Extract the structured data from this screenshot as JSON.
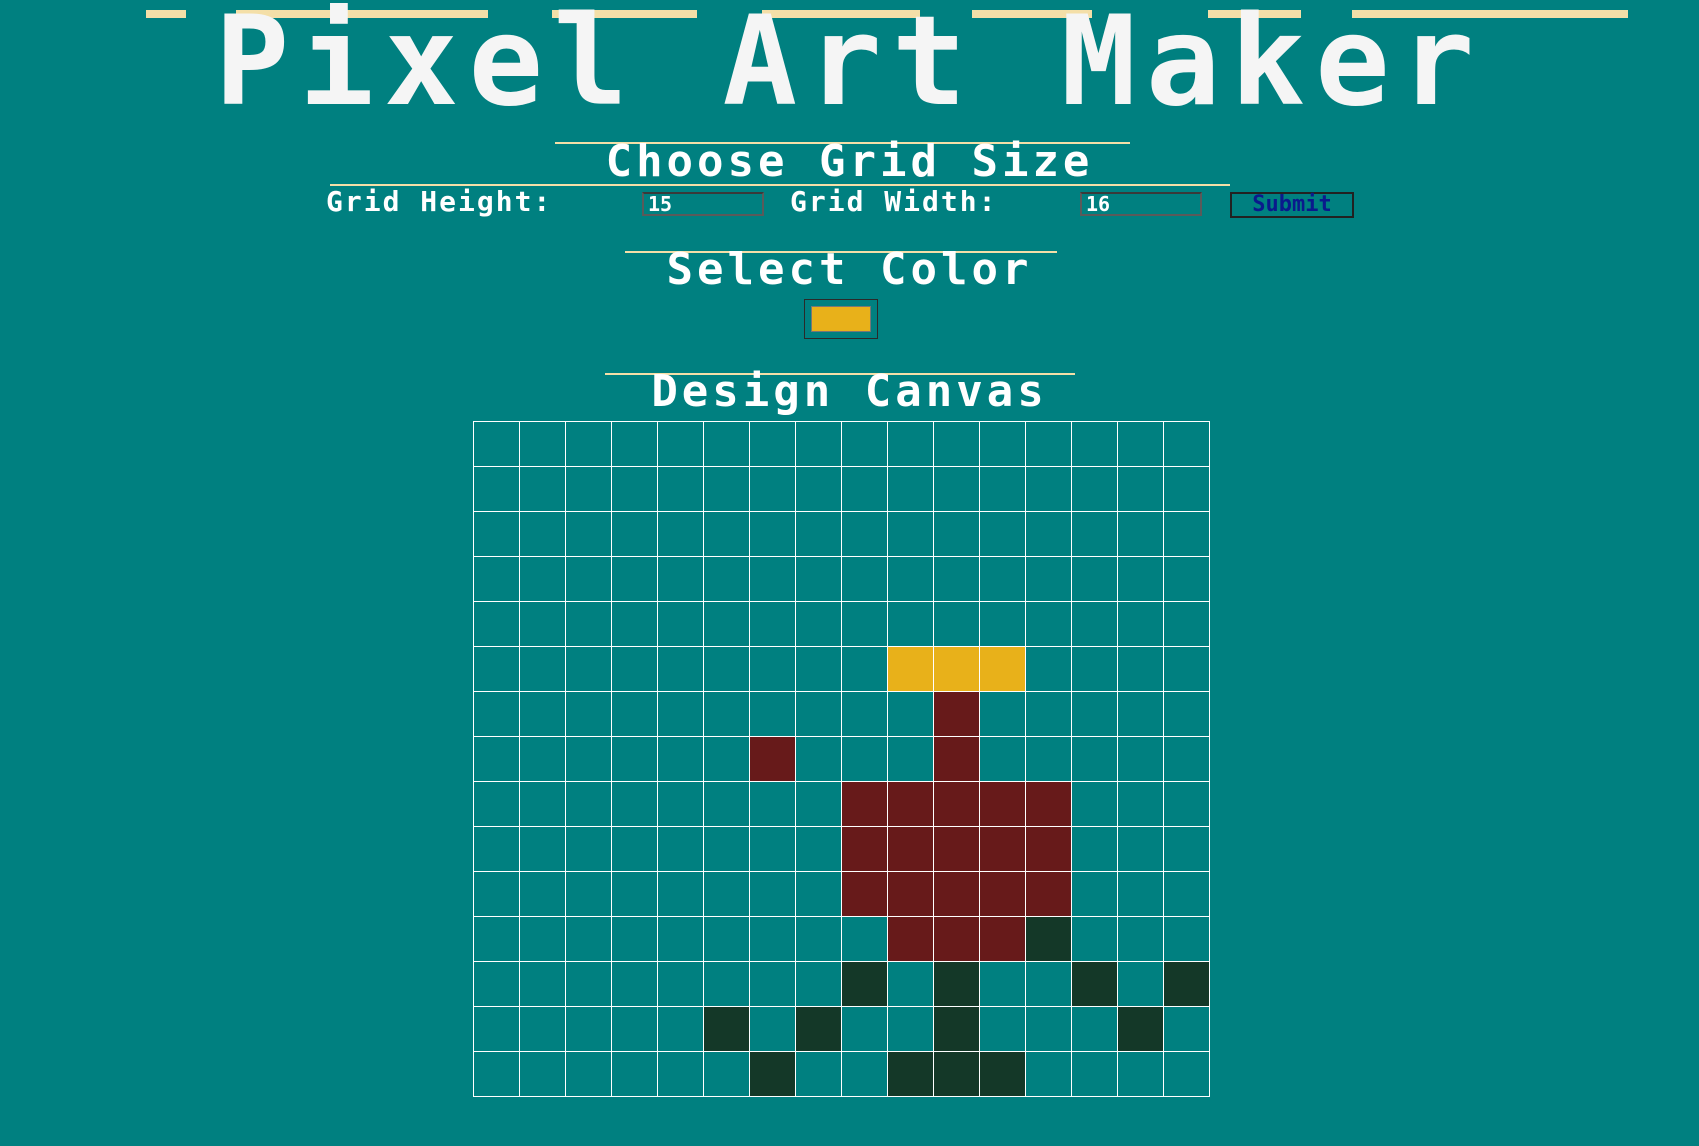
{
  "title": "Pixel Art Maker",
  "size_section": {
    "heading": "Choose Grid Size",
    "height_label": "Grid Height:",
    "height_value": "15",
    "width_label": "Grid Width:",
    "width_value": "16",
    "submit_label": "Submit"
  },
  "color_section": {
    "heading": "Select Color",
    "selected_color": "#e8b11a"
  },
  "canvas_section": {
    "heading": "Design Canvas",
    "rows": 15,
    "cols": 16,
    "background_color": "#008080",
    "painted_cells": [
      {
        "row": 5,
        "col": 9,
        "color": "#e8b11a"
      },
      {
        "row": 5,
        "col": 10,
        "color": "#e8b11a"
      },
      {
        "row": 5,
        "col": 11,
        "color": "#e8b11a"
      },
      {
        "row": 6,
        "col": 10,
        "color": "#671a1a"
      },
      {
        "row": 7,
        "col": 6,
        "color": "#671a1a"
      },
      {
        "row": 7,
        "col": 10,
        "color": "#671a1a"
      },
      {
        "row": 8,
        "col": 8,
        "color": "#671a1a"
      },
      {
        "row": 8,
        "col": 9,
        "color": "#671a1a"
      },
      {
        "row": 8,
        "col": 10,
        "color": "#671a1a"
      },
      {
        "row": 8,
        "col": 11,
        "color": "#671a1a"
      },
      {
        "row": 8,
        "col": 12,
        "color": "#671a1a"
      },
      {
        "row": 9,
        "col": 8,
        "color": "#671a1a"
      },
      {
        "row": 9,
        "col": 9,
        "color": "#671a1a"
      },
      {
        "row": 9,
        "col": 10,
        "color": "#671a1a"
      },
      {
        "row": 9,
        "col": 11,
        "color": "#671a1a"
      },
      {
        "row": 9,
        "col": 12,
        "color": "#671a1a"
      },
      {
        "row": 10,
        "col": 8,
        "color": "#671a1a"
      },
      {
        "row": 10,
        "col": 9,
        "color": "#671a1a"
      },
      {
        "row": 10,
        "col": 10,
        "color": "#671a1a"
      },
      {
        "row": 10,
        "col": 11,
        "color": "#671a1a"
      },
      {
        "row": 10,
        "col": 12,
        "color": "#671a1a"
      },
      {
        "row": 11,
        "col": 9,
        "color": "#671a1a"
      },
      {
        "row": 11,
        "col": 10,
        "color": "#671a1a"
      },
      {
        "row": 11,
        "col": 11,
        "color": "#671a1a"
      },
      {
        "row": 11,
        "col": 12,
        "color": "#143828"
      },
      {
        "row": 12,
        "col": 8,
        "color": "#143828"
      },
      {
        "row": 12,
        "col": 10,
        "color": "#143828"
      },
      {
        "row": 12,
        "col": 13,
        "color": "#143828"
      },
      {
        "row": 12,
        "col": 15,
        "color": "#143828"
      },
      {
        "row": 13,
        "col": 5,
        "color": "#143828"
      },
      {
        "row": 13,
        "col": 7,
        "color": "#143828"
      },
      {
        "row": 13,
        "col": 10,
        "color": "#143828"
      },
      {
        "row": 13,
        "col": 14,
        "color": "#143828"
      },
      {
        "row": 14,
        "col": 6,
        "color": "#143828"
      },
      {
        "row": 14,
        "col": 9,
        "color": "#143828"
      },
      {
        "row": 14,
        "col": 10,
        "color": "#143828"
      },
      {
        "row": 14,
        "col": 11,
        "color": "#143828"
      }
    ]
  }
}
